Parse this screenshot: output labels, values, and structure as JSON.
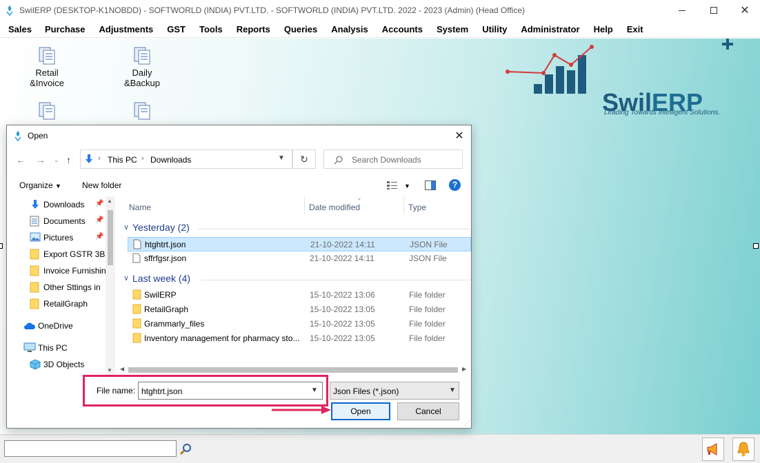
{
  "window": {
    "title": "SwilERP (DESKTOP-K1NOBDD) - SOFTWORLD (INDIA) PVT.LTD. - SOFTWORLD (INDIA) PVT.LTD.  2022 - 2023 (Admin) (Head Office)"
  },
  "menu": [
    "Sales",
    "Purchase",
    "Adjustments",
    "GST",
    "Tools",
    "Reports",
    "Queries",
    "Analysis",
    "Accounts",
    "System",
    "Utility",
    "Administrator",
    "Help",
    "Exit"
  ],
  "shortcuts": [
    {
      "line1": "Retail",
      "line2": "&Invoice"
    },
    {
      "line1": "Daily",
      "line2": "&Backup"
    }
  ],
  "logo": {
    "name_part1": "Swil",
    "name_part2": "ERP",
    "tagline": "Leading Towards Intelligent Solutions."
  },
  "dialog": {
    "title": "Open",
    "breadcrumb": [
      "This PC",
      "Downloads"
    ],
    "search_placeholder": "Search Downloads",
    "organize_label": "Organize",
    "new_folder_label": "New folder",
    "nav_items": [
      {
        "label": "Downloads",
        "icon": "download-icon",
        "pinned": true
      },
      {
        "label": "Documents",
        "icon": "document-icon",
        "pinned": true
      },
      {
        "label": "Pictures",
        "icon": "picture-icon",
        "pinned": true
      },
      {
        "label": "Export GSTR 3B (",
        "icon": "folder-icon",
        "pinned": false
      },
      {
        "label": "Invoice Furnishin",
        "icon": "folder-icon",
        "pinned": false
      },
      {
        "label": "Other Sttings in",
        "icon": "folder-icon",
        "pinned": false
      },
      {
        "label": "RetailGraph",
        "icon": "folder-icon",
        "pinned": false
      },
      {
        "label": "OneDrive",
        "icon": "cloud-icon",
        "pinned": false
      },
      {
        "label": "This PC",
        "icon": "computer-icon",
        "pinned": false
      },
      {
        "label": "3D Objects",
        "icon": "cube-icon",
        "pinned": false
      }
    ],
    "columns": {
      "name": "Name",
      "date": "Date modified",
      "type": "Type"
    },
    "groups": [
      {
        "label": "Yesterday (2)",
        "files": [
          {
            "name": "htghtrt.json",
            "date": "21-10-2022 14:11",
            "type": "JSON File",
            "selected": true
          },
          {
            "name": "sffrfgsr.json",
            "date": "21-10-2022 14:11",
            "type": "JSON File",
            "selected": false
          }
        ]
      },
      {
        "label": "Last week (4)",
        "files": [
          {
            "name": "SwilERP",
            "date": "15-10-2022 13:06",
            "type": "File folder",
            "selected": false
          },
          {
            "name": "RetailGraph",
            "date": "15-10-2022 13:05",
            "type": "File folder",
            "selected": false
          },
          {
            "name": "Grammarly_files",
            "date": "15-10-2022 13:05",
            "type": "File folder",
            "selected": false
          },
          {
            "name": "Inventory management for pharmacy sto...",
            "date": "15-10-2022 13:05",
            "type": "File folder",
            "selected": false
          }
        ]
      }
    ],
    "file_name_label": "File name:",
    "file_name_value": "htghtrt.json",
    "file_type": "Json Files (*.json)",
    "open_label": "Open",
    "cancel_label": "Cancel"
  },
  "colors": {
    "highlight": "#e0245e",
    "accent": "#0b66d0",
    "selection": "#cce8ff",
    "group_text": "#1e3d8f"
  }
}
